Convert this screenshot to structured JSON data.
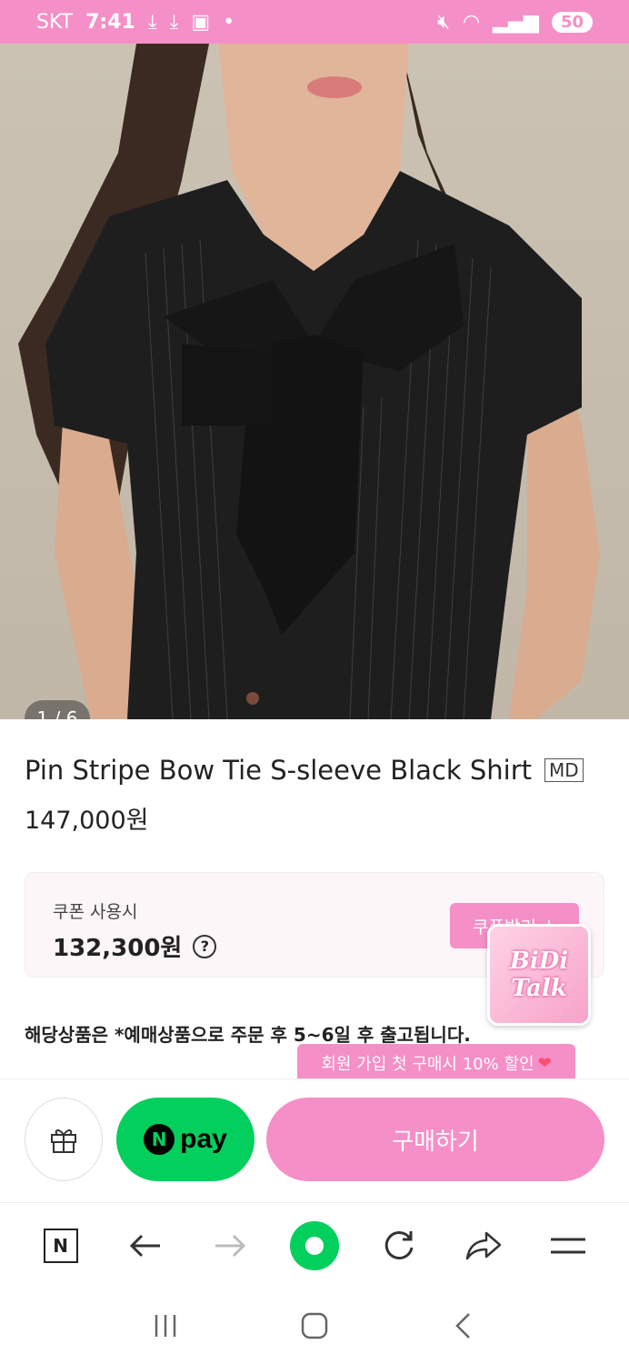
{
  "status_bar": {
    "carrier": "SKT",
    "time": "7:41",
    "battery": "50",
    "background_color": "#f58fc7"
  },
  "gallery": {
    "indicator": "1 / 6"
  },
  "product": {
    "title": "Pin Stripe Bow Tie S-sleeve Black Shirt",
    "badge": "MD",
    "price": "147,000원"
  },
  "coupon": {
    "label": "쿠폰 사용시",
    "price": "132,300원",
    "help_icon": "?",
    "button_label": "쿠폰받기 ↓"
  },
  "chat_widget": {
    "logo_text_line1": "BiDi",
    "logo_text_line2": "Talk"
  },
  "notice": "해당상품은 *예매상품으로 주문 후 5~6일 후 출고됩니다.",
  "promo_tooltip": {
    "text": "회원 가입 첫 구매시 10% 할인",
    "heart": "❤"
  },
  "actions": {
    "npay_n": "N",
    "npay_label": "pay",
    "buy_label": "구매하기"
  },
  "browser_nav": {
    "home_label": "N"
  },
  "colors": {
    "accent_pink": "#f58fc7",
    "npay_green": "#03cf5d"
  }
}
